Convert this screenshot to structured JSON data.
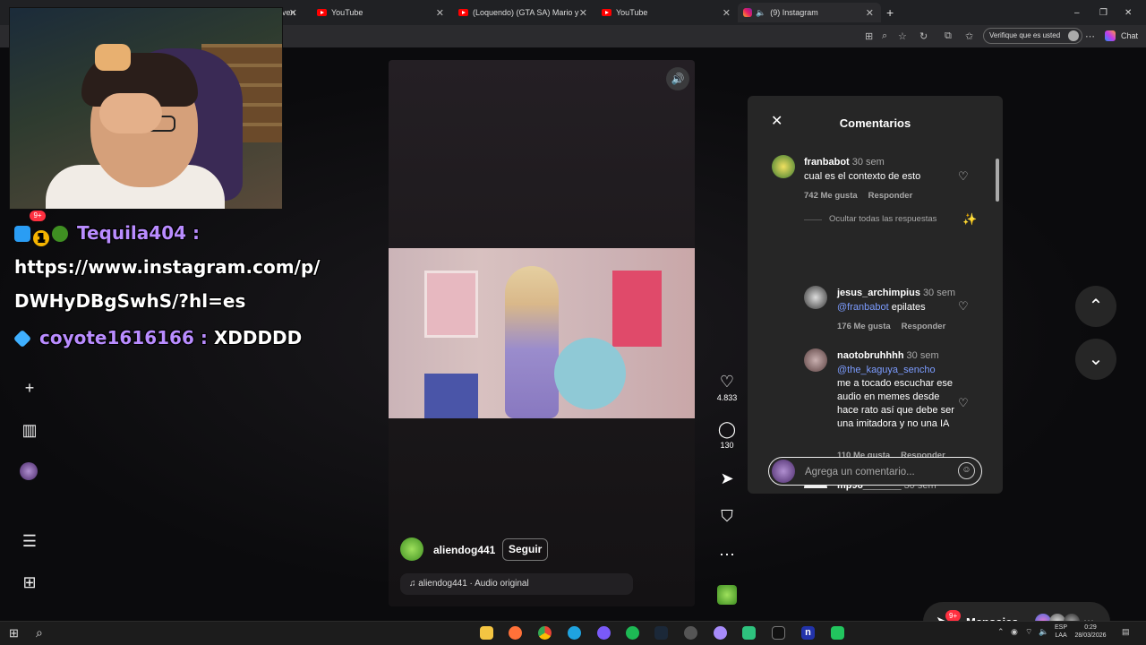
{
  "browser": {
    "tabs": [
      {
        "label": "ven",
        "icon": "none"
      },
      {
        "label": "YouTube",
        "icon": "youtube"
      },
      {
        "label": "(Loquendo) (GTA SA) Mario y Luigi",
        "icon": "youtube"
      },
      {
        "label": "YouTube",
        "icon": "youtube"
      },
      {
        "label": "(9) Instagram",
        "icon": "instagram",
        "active": true
      }
    ],
    "new_tab": "+",
    "window_controls": [
      "–",
      "❐",
      "✕"
    ],
    "verify_label": "Verifique que es usted",
    "chat_label": "Chat"
  },
  "stream_overlay": {
    "chat": [
      {
        "user": "Tequila404",
        "sep": " :",
        "message": ""
      },
      {
        "user": "",
        "sep": "",
        "message": "https://www.instagram.com/p/"
      },
      {
        "user": "",
        "sep": "",
        "message": "DWHyDBgSwhS/?hl=es"
      },
      {
        "user": "coyote1616166",
        "sep": " : ",
        "message": "XDDDDD"
      }
    ],
    "badge_number": "1"
  },
  "sidebar": {
    "notification_count": "9+",
    "icons": [
      "plus-icon",
      "insights-icon",
      "profile-avatar",
      "menu-icon",
      "more-apps-icon"
    ]
  },
  "reel": {
    "author": "aliendog441",
    "follow_label": "Seguir",
    "audio": "aliendog441 · Audio original",
    "likes": "4.833",
    "comments": "130"
  },
  "comments_panel": {
    "title": "Comentarios",
    "hide_replies": "Ocultar todas las respuestas",
    "input_placeholder": "Agrega un comentario...",
    "items": [
      {
        "user": "franbabot",
        "time": "30 sem",
        "mention": "",
        "text": "cual es el contexto de esto",
        "likes": "742 Me gusta",
        "reply": "Responder"
      },
      {
        "user": "jesus_archimpius",
        "time": "30 sem",
        "mention": "@franbabot",
        "text": " epilates",
        "likes": "176 Me gusta",
        "reply": "Responder"
      },
      {
        "user": "naotobruhhhh",
        "time": "30 sem",
        "mention": "@the_kaguya_sencho",
        "text": "me a tocado escuchar ese audio en memes desde hace rato así que debe ser una imitadora y no una IA",
        "likes": "110 Me gusta",
        "reply": "Responder"
      },
      {
        "user": "mp98_______",
        "time": "30 sem",
        "mention": "",
        "text": "",
        "likes": "",
        "reply": ""
      }
    ]
  },
  "messages": {
    "label": "Mensajes",
    "badge": "9+"
  },
  "taskbar": {
    "lang_top": "ESP",
    "lang_bottom": "LAA",
    "time": "0:29",
    "date": "28/03/2026"
  },
  "colors": {
    "accent_mention": "#7c9cff",
    "notification_red": "#ff3040",
    "chat_username": "#b98cff"
  }
}
